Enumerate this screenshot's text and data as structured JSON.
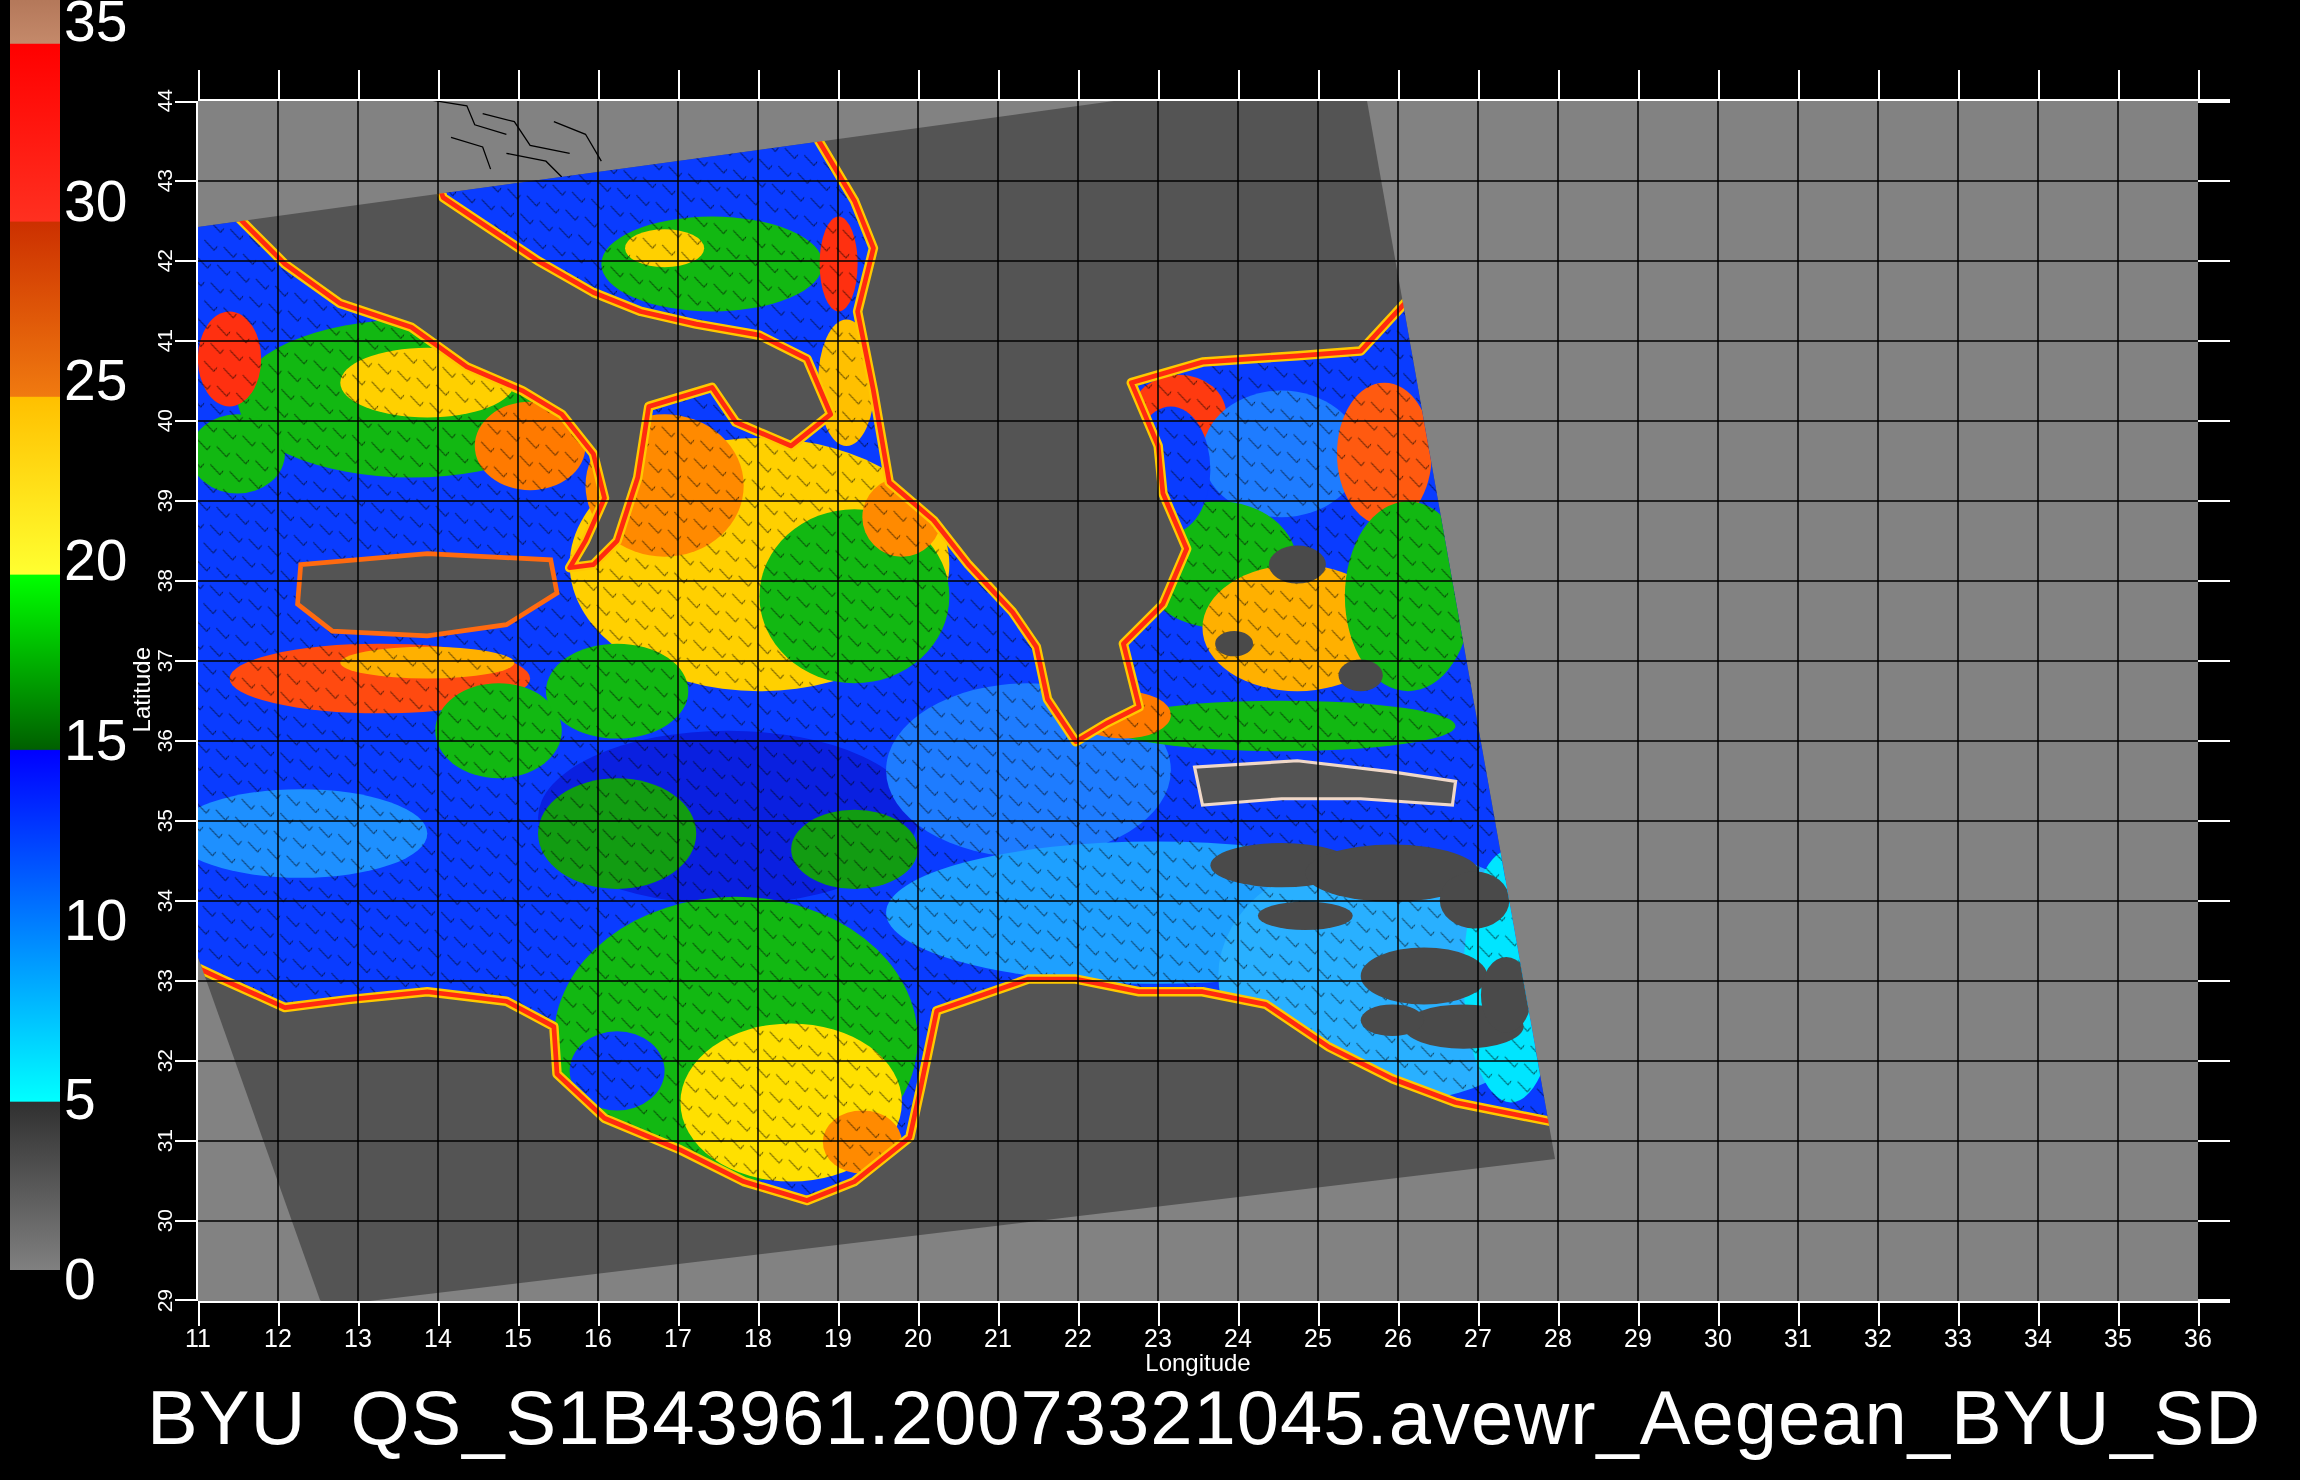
{
  "color_scale": {
    "labels": [
      "35",
      "30",
      "25",
      "20",
      "15",
      "10",
      "5",
      "0"
    ]
  },
  "y_axis": {
    "label": "Latitude",
    "ticks": [
      "44",
      "43",
      "42",
      "41",
      "40",
      "39",
      "38",
      "37",
      "36",
      "35",
      "34",
      "33",
      "32",
      "31",
      "30",
      "29"
    ]
  },
  "x_axis": {
    "label": "Longitude",
    "ticks": [
      "11",
      "12",
      "13",
      "14",
      "15",
      "16",
      "17",
      "18",
      "19",
      "20",
      "21",
      "22",
      "23",
      "24",
      "25",
      "26",
      "27",
      "28",
      "29",
      "30",
      "31",
      "32",
      "33",
      "34",
      "35",
      "36"
    ]
  },
  "title": "BYU  QS_S1B43961.20073321045.avewr_Aegean_BYU_SD"
}
